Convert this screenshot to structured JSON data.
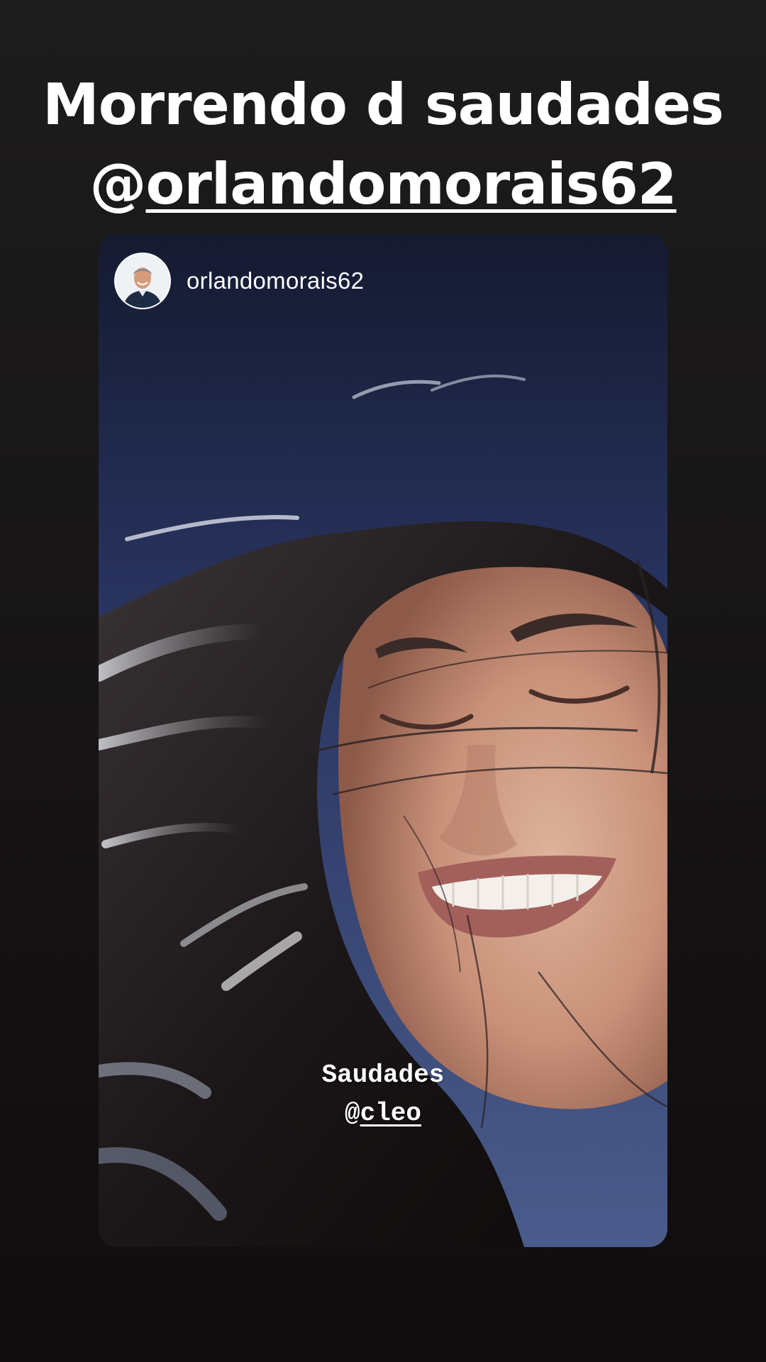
{
  "story": {
    "caption_line1": "Morrendo d saudades",
    "mention_prefix": "@",
    "mention_handle": "orlandomorais62"
  },
  "shared_post": {
    "username": "orlandomorais62",
    "caption_line1": "Saudades",
    "caption_mention_prefix": "@",
    "caption_mention_handle": "cleo"
  },
  "colors": {
    "background": "#171516",
    "text": "#ffffff",
    "sky": "#2a3765"
  }
}
